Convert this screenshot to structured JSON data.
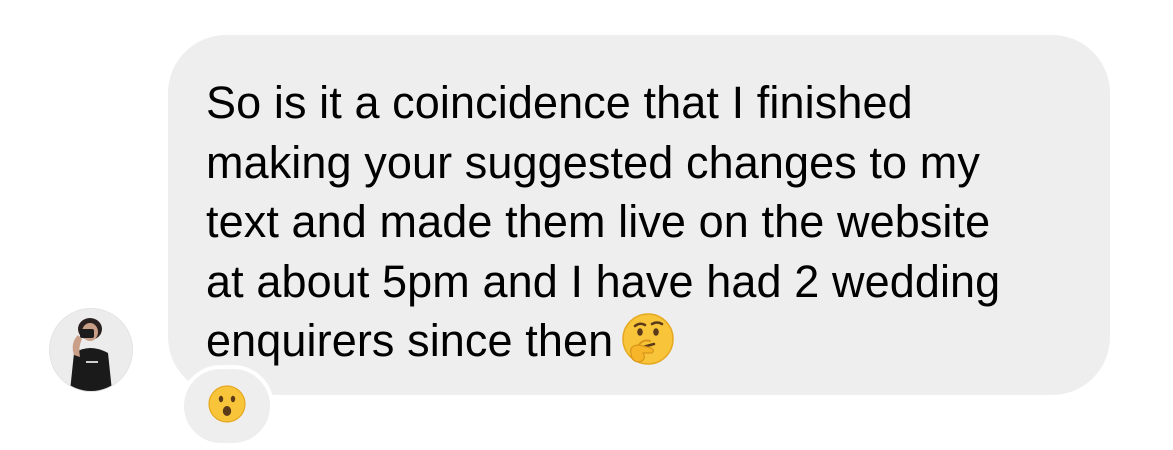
{
  "conversation": {
    "incoming_message": {
      "lines": [
        "So is it a coincidence that I finished",
        "making your suggested changes to my",
        "text and made them live on the website",
        "at about 5pm and I have had 2 wedding",
        "enquirers since then"
      ],
      "trailing_emoji": "thinking-face-emoji",
      "reaction_emoji": "face-with-open-mouth-emoji"
    },
    "sender_avatar": "avatar-photo"
  },
  "colors": {
    "bubble": "#eeeeee",
    "text": "#000000",
    "emoji_yellow": "#f7c43a",
    "emoji_dark": "#5b3a1a"
  }
}
